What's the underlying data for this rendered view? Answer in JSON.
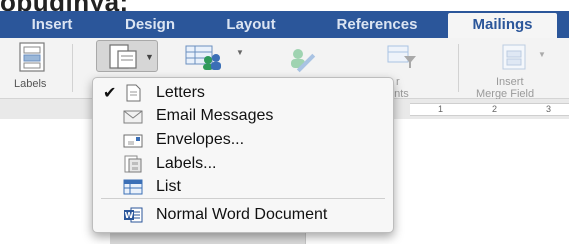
{
  "top_text": "obuginya:",
  "tabs": [
    {
      "label": "Insert"
    },
    {
      "label": "Design"
    },
    {
      "label": "Layout"
    },
    {
      "label": "References"
    },
    {
      "label": "Mailings"
    }
  ],
  "ribbon": {
    "labels_button": "Labels",
    "partial_1": "r",
    "partial_2": "ents",
    "insert_merge_1": "Insert",
    "insert_merge_2": "Merge Field"
  },
  "ruler": {
    "ticks": [
      "1",
      "2",
      "3"
    ]
  },
  "menu": {
    "items": [
      {
        "label": "Letters",
        "checked": true,
        "icon": "letter-icon"
      },
      {
        "label": "Email Messages",
        "checked": false,
        "icon": "envelope-icon"
      },
      {
        "label": "Envelopes...",
        "checked": false,
        "icon": "envelope-stamp-icon"
      },
      {
        "label": "Labels...",
        "checked": false,
        "icon": "labels-icon"
      },
      {
        "label": "List",
        "checked": false,
        "icon": "list-icon"
      }
    ],
    "normal": {
      "label": "Normal Word Document",
      "icon": "word-document-icon"
    }
  },
  "colors": {
    "tab_bar": "#2b569a",
    "accent_green": "#2e9a5a"
  }
}
